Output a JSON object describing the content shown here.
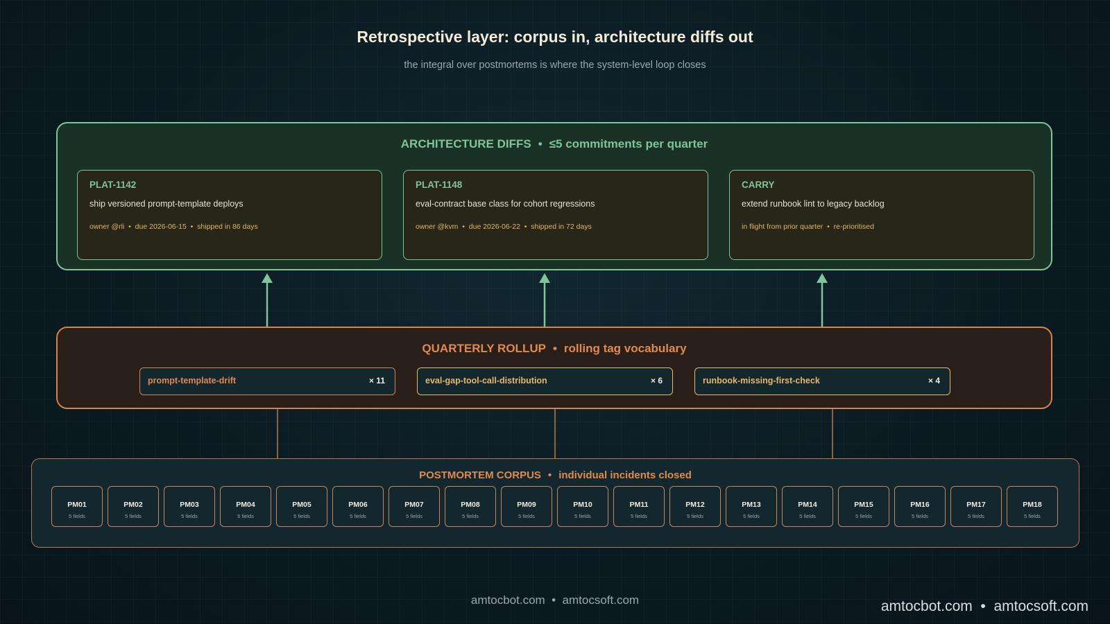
{
  "title": "Retrospective layer: corpus in, architecture diffs out",
  "subtitle": "the integral over postmortems is where the system-level loop closes",
  "separator": "•",
  "architecture": {
    "heading": "ARCHITECTURE DIFFS",
    "subheading": "≤5 commitments per quarter",
    "color": "#7fc49c",
    "cards": [
      {
        "id": "PLAT-1142",
        "description": "ship versioned prompt-template deploys",
        "meta": "owner @rli  •  due 2026-06-15  •  shipped in 86 days"
      },
      {
        "id": "PLAT-1148",
        "description": "eval-contract base class for cohort regressions",
        "meta": "owner @kvm  •  due 2026-06-22  •  shipped in 72 days"
      },
      {
        "id": "CARRY",
        "description": "extend runbook lint to legacy backlog",
        "meta": "in flight from prior quarter  •  re-prioritised"
      }
    ]
  },
  "rollup": {
    "heading": "QUARTERLY ROLLUP",
    "subheading": "rolling tag vocabulary",
    "color": "#e08a4e",
    "tags": [
      {
        "name": "prompt-template-drift",
        "count": "× 11"
      },
      {
        "name": "eval-gap-tool-call-distribution",
        "count": "× 6"
      },
      {
        "name": "runbook-missing-first-check",
        "count": "× 4"
      }
    ]
  },
  "corpus": {
    "heading": "POSTMORTEM CORPUS",
    "subheading": "individual incidents closed",
    "items": [
      {
        "label": "PM01",
        "sub": "5 fields"
      },
      {
        "label": "PM02",
        "sub": "5 fields"
      },
      {
        "label": "PM03",
        "sub": "5 fields"
      },
      {
        "label": "PM04",
        "sub": "5 fields"
      },
      {
        "label": "PM05",
        "sub": "5 fields"
      },
      {
        "label": "PM06",
        "sub": "5 fields"
      },
      {
        "label": "PM07",
        "sub": "5 fields"
      },
      {
        "label": "PM08",
        "sub": "5 fields"
      },
      {
        "label": "PM09",
        "sub": "5 fields"
      },
      {
        "label": "PM10",
        "sub": "5 fields"
      },
      {
        "label": "PM11",
        "sub": "5 fields"
      },
      {
        "label": "PM12",
        "sub": "5 fields"
      },
      {
        "label": "PM13",
        "sub": "5 fields"
      },
      {
        "label": "PM14",
        "sub": "5 fields"
      },
      {
        "label": "PM15",
        "sub": "5 fields"
      },
      {
        "label": "PM16",
        "sub": "5 fields"
      },
      {
        "label": "PM17",
        "sub": "5 fields"
      },
      {
        "label": "PM18",
        "sub": "5 fields"
      }
    ]
  },
  "footer": {
    "center": "amtocbot.com  •  amtocsoft.com",
    "right": "amtocbot.com  •  amtocsoft.com"
  }
}
